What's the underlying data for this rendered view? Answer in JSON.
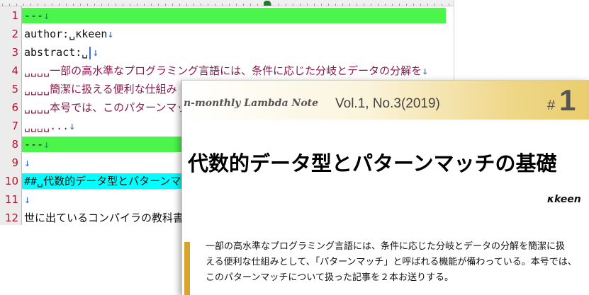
{
  "editor": {
    "lines": [
      {
        "num": "1",
        "text": "---",
        "highlight": "green"
      },
      {
        "num": "2",
        "text": "author:␣κkeen",
        "highlight": ""
      },
      {
        "num": "3",
        "text": "abstract:␣",
        "highlight": ""
      },
      {
        "num": "4",
        "text": "␣␣␣␣一部の高水準なプログラミング言語には、条件に応じた分岐とデータの分解を",
        "highlight": ""
      },
      {
        "num": "5",
        "text": "␣␣␣␣簡潔に扱える便利な仕組み",
        "highlight": ""
      },
      {
        "num": "6",
        "text": "␣␣␣␣本号では、このパターンマッチ",
        "highlight": ""
      },
      {
        "num": "7",
        "text": "␣␣␣␣...",
        "highlight": ""
      },
      {
        "num": "8",
        "text": "---",
        "highlight": "green"
      },
      {
        "num": "9",
        "text": "",
        "highlight": ""
      },
      {
        "num": "10",
        "text": "##␣代数的データ型とパターンマッ",
        "highlight": "cyan"
      },
      {
        "num": "11",
        "text": "",
        "highlight": ""
      },
      {
        "num": "12",
        "text": "世に出ているコンパイラの教科書は",
        "highlight": ""
      }
    ],
    "newline_glyph": "↓"
  },
  "preview": {
    "journal_name": "n-monthly Lambda Note",
    "volume": "Vol.1, No.3(2019)",
    "hash": "#",
    "issue_number": "1",
    "title": "代数的データ型とパターンマッチの基礎",
    "author": "κkeen",
    "abstract_lines": [
      "一部の高水準なプログラミング言語には、条件に応じた分岐とデータの分解を簡潔に扱",
      "える便利な仕組みとして、「パターンマッチ」と呼ばれる機能が備わっている。本号では、",
      "このパターンマッチについて扱った記事を２本お送りする。"
    ]
  },
  "colors": {
    "line_number": "#b5152b",
    "highlight_green": "#4cf54c",
    "highlight_cyan": "#00ffff",
    "abstract_text": "#8b1a4a",
    "accent_bar": "#d7a52b"
  }
}
